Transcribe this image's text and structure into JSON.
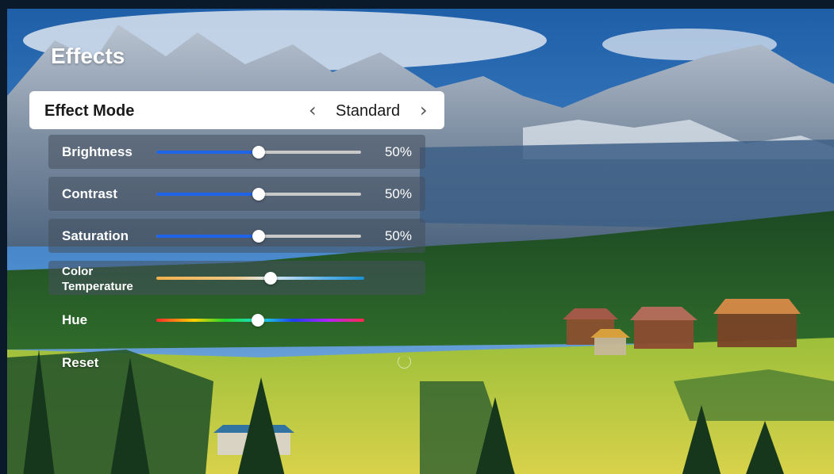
{
  "menu": {
    "title": "Effects",
    "effect_mode": {
      "label": "Effect Mode",
      "value": "Standard",
      "prev_icon": "chevron-left-icon",
      "next_icon": "chevron-right-icon"
    },
    "sliders": [
      {
        "label": "Brightness",
        "value": "50%",
        "level": 0.5
      },
      {
        "label": "Contrast",
        "value": "50%",
        "level": 0.5
      },
      {
        "label": "Saturation",
        "value": "50%",
        "level": 0.5
      },
      {
        "label_line1": "Color",
        "label_line2": "Temperature",
        "level": 0.55
      },
      {
        "label": "Hue",
        "level": 0.49
      }
    ],
    "reset": {
      "label": "Reset",
      "icon": "loading-spinner-icon"
    }
  },
  "colors": {
    "slider_fill": "#1e63e8",
    "selected_bg": "#ffffff",
    "row_bg": "rgba(70,80,95,0.55)"
  }
}
